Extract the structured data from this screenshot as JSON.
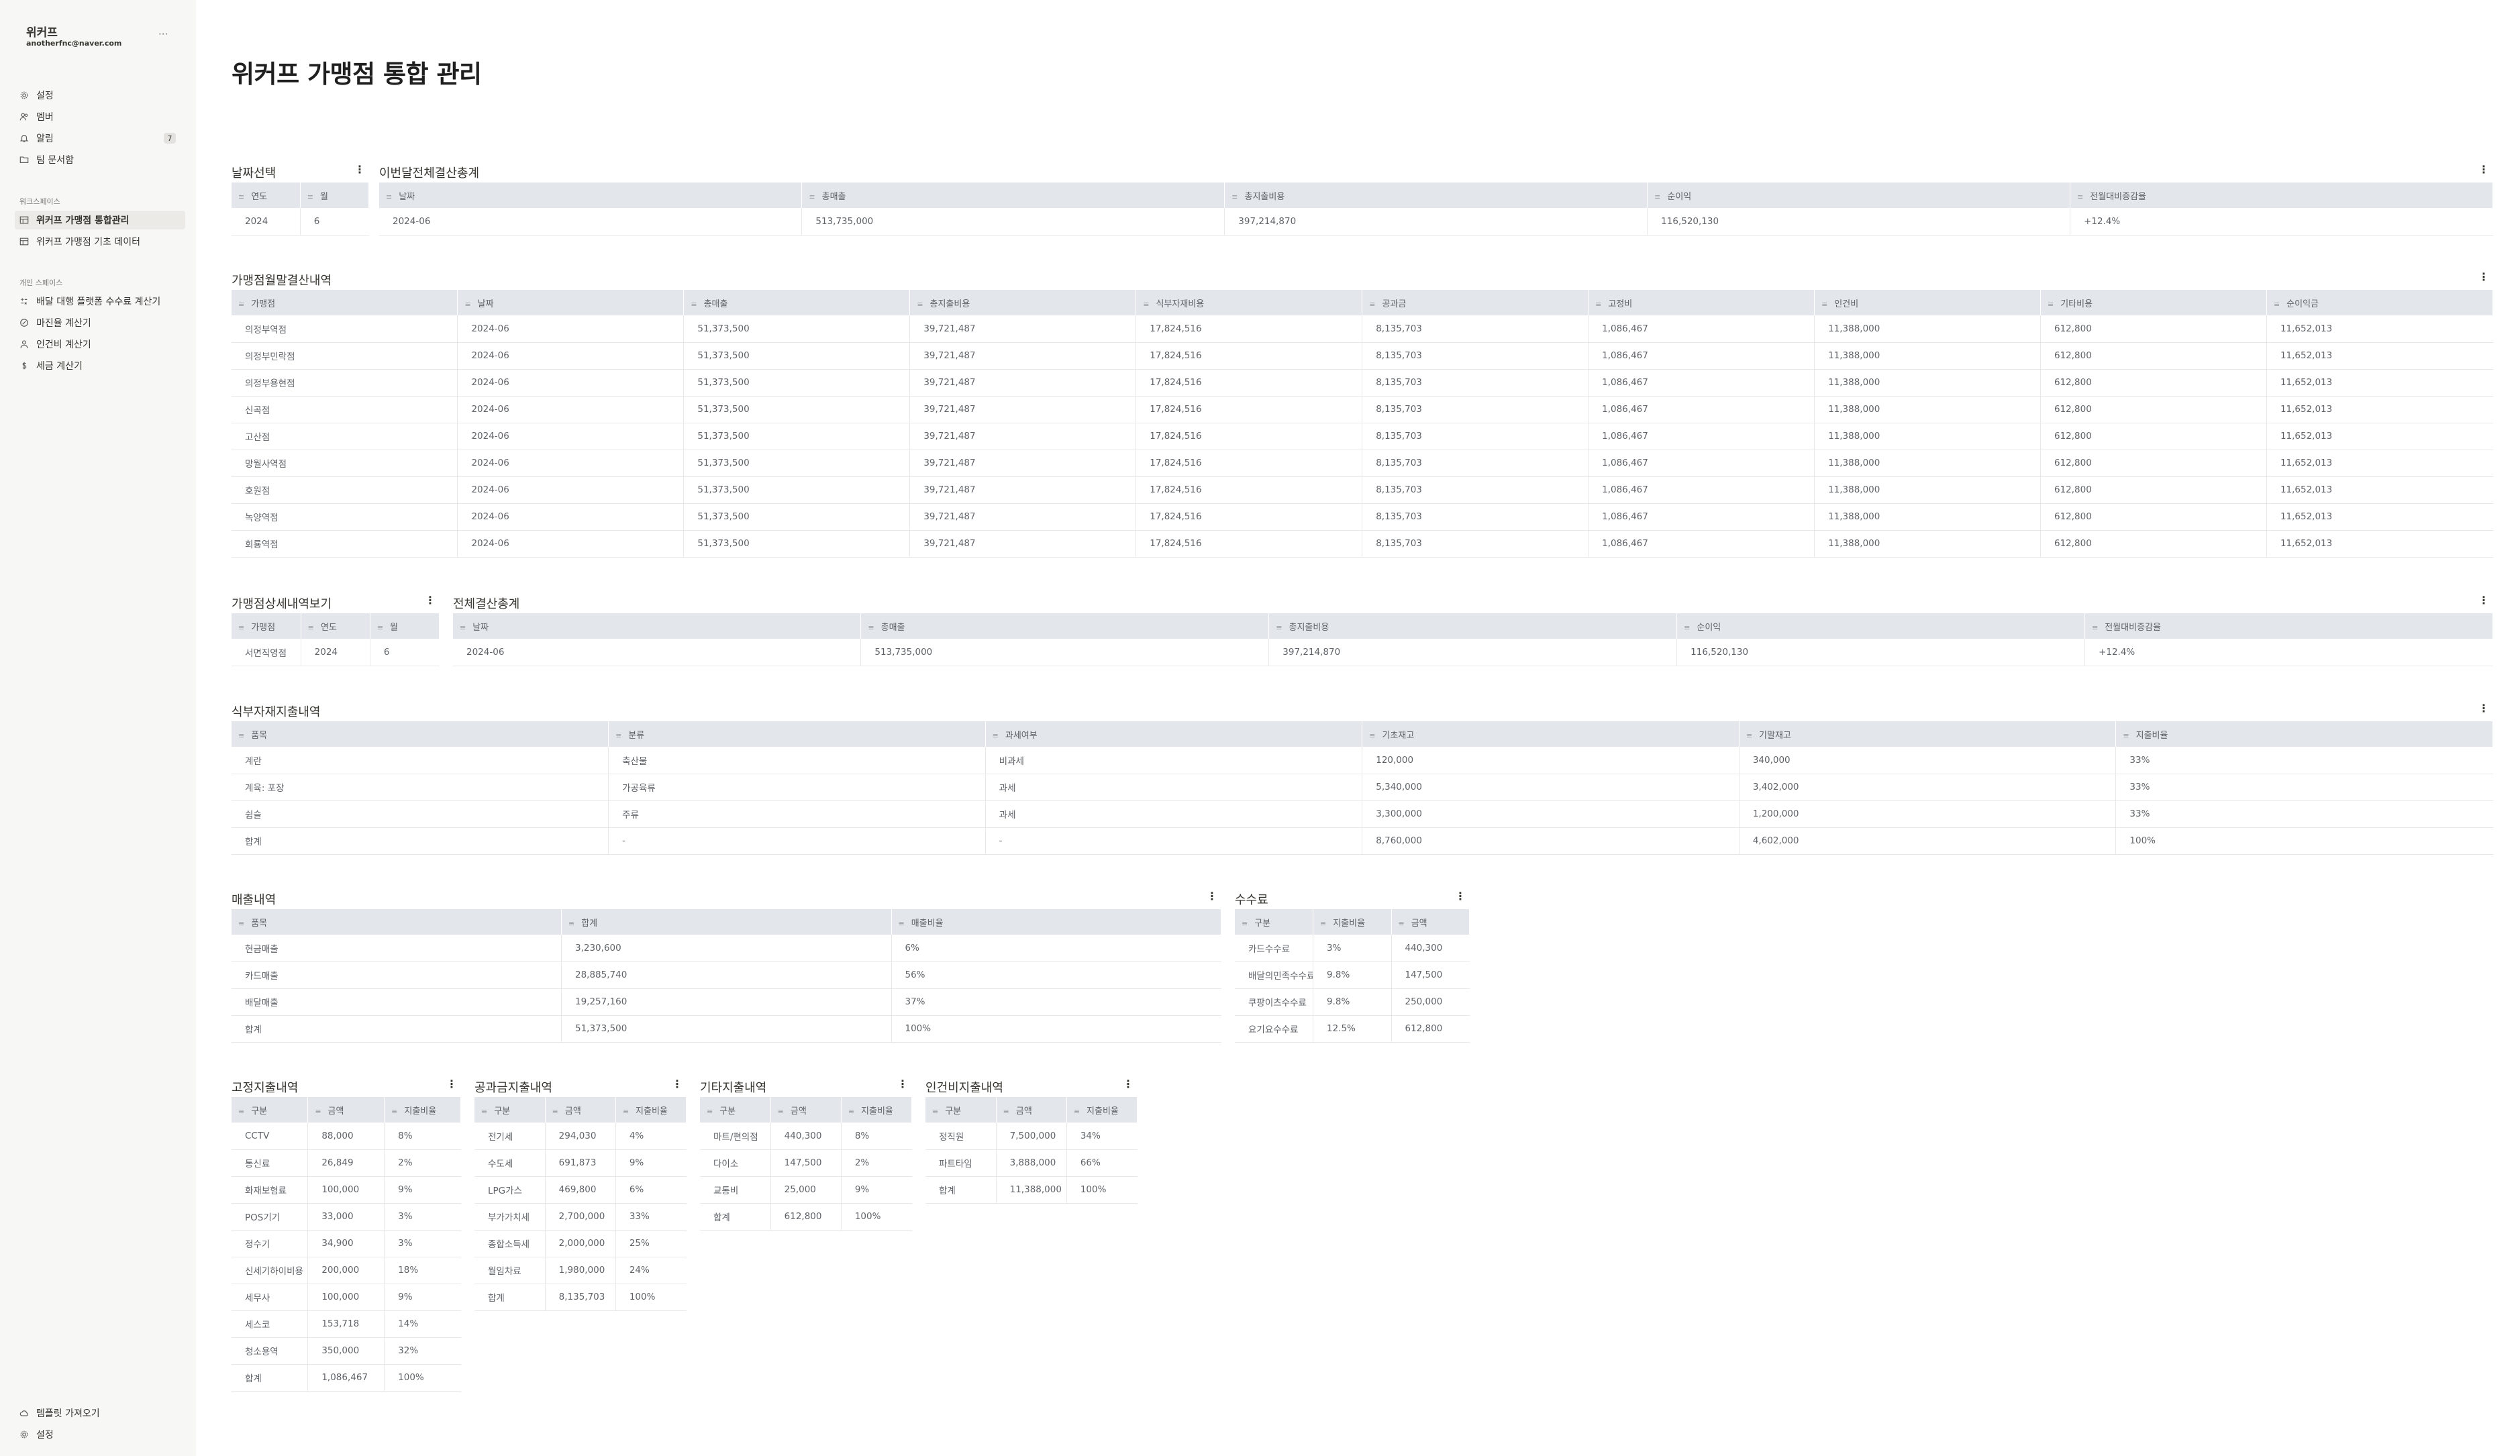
{
  "sidebar": {
    "workspace_name": "위커프",
    "email": "anotherfnc@naver.com",
    "more": "···",
    "top_items": [
      {
        "label": "설정",
        "icon": "gear-icon"
      },
      {
        "label": "멤버",
        "icon": "members-icon"
      },
      {
        "label": "알림",
        "icon": "bell-icon",
        "badge": "7"
      },
      {
        "label": "팀 문서함",
        "icon": "folder-icon"
      }
    ],
    "section_team": "워크스페이스",
    "team_items": [
      {
        "label": "위커프 가맹점 통합관리",
        "icon": "table-icon",
        "active": true
      },
      {
        "label": "위커프 가맹점 기초 데이터",
        "icon": "table-icon",
        "active": false
      }
    ],
    "section_personal": "개인 스페이스",
    "personal_items": [
      {
        "label": "배달 대행 플랫폼 수수료 계산기",
        "icon": "calculator-icon"
      },
      {
        "label": "마진율 계산기",
        "icon": "percent-icon"
      },
      {
        "label": "인건비 계산기",
        "icon": "person-icon"
      },
      {
        "label": "세금 계산기",
        "icon": "dollar-icon"
      }
    ],
    "bottom_items": [
      {
        "label": "템플릿 가져오기",
        "icon": "cloud-icon"
      },
      {
        "label": "설정",
        "icon": "gear-icon"
      }
    ]
  },
  "page_title": "위커프 가맹점 통합 관리",
  "views": {
    "date_select": {
      "title": "날짜선택",
      "columns": [
        "연도",
        "월"
      ],
      "rows": [
        [
          "2024",
          "6"
        ]
      ]
    },
    "month_total": {
      "title": "이번달전체결산총계",
      "columns": [
        "날짜",
        "총매출",
        "총지출비용",
        "순이익",
        "전월대비증감율"
      ],
      "rows": [
        [
          "2024-06",
          "513,735,000",
          "397,214,870",
          "116,520,130",
          "+12.4%"
        ]
      ]
    },
    "store_monthly": {
      "title": "가맹점월말결산내역",
      "columns": [
        "가맹점",
        "날짜",
        "총매출",
        "총지출비용",
        "식부자재비용",
        "공과금",
        "고정비",
        "인건비",
        "기타비용",
        "순이익금"
      ],
      "rows": [
        [
          "의정부역점",
          "2024-06",
          "51,373,500",
          "39,721,487",
          "17,824,516",
          "8,135,703",
          "1,086,467",
          "11,388,000",
          "612,800",
          "11,652,013"
        ],
        [
          "의정부민락점",
          "2024-06",
          "51,373,500",
          "39,721,487",
          "17,824,516",
          "8,135,703",
          "1,086,467",
          "11,388,000",
          "612,800",
          "11,652,013"
        ],
        [
          "의정부용현점",
          "2024-06",
          "51,373,500",
          "39,721,487",
          "17,824,516",
          "8,135,703",
          "1,086,467",
          "11,388,000",
          "612,800",
          "11,652,013"
        ],
        [
          "신곡점",
          "2024-06",
          "51,373,500",
          "39,721,487",
          "17,824,516",
          "8,135,703",
          "1,086,467",
          "11,388,000",
          "612,800",
          "11,652,013"
        ],
        [
          "고산점",
          "2024-06",
          "51,373,500",
          "39,721,487",
          "17,824,516",
          "8,135,703",
          "1,086,467",
          "11,388,000",
          "612,800",
          "11,652,013"
        ],
        [
          "망월사역점",
          "2024-06",
          "51,373,500",
          "39,721,487",
          "17,824,516",
          "8,135,703",
          "1,086,467",
          "11,388,000",
          "612,800",
          "11,652,013"
        ],
        [
          "호원점",
          "2024-06",
          "51,373,500",
          "39,721,487",
          "17,824,516",
          "8,135,703",
          "1,086,467",
          "11,388,000",
          "612,800",
          "11,652,013"
        ],
        [
          "녹양역점",
          "2024-06",
          "51,373,500",
          "39,721,487",
          "17,824,516",
          "8,135,703",
          "1,086,467",
          "11,388,000",
          "612,800",
          "11,652,013"
        ],
        [
          "회룡역점",
          "2024-06",
          "51,373,500",
          "39,721,487",
          "17,824,516",
          "8,135,703",
          "1,086,467",
          "11,388,000",
          "612,800",
          "11,652,013"
        ]
      ]
    },
    "store_detail": {
      "title": "가맹점상세내역보기",
      "columns": [
        "가맹점",
        "연도",
        "월"
      ],
      "rows": [
        [
          "서면직영점",
          "2024",
          "6"
        ]
      ]
    },
    "total_summary": {
      "title": "전체결산총계",
      "columns": [
        "날짜",
        "총매출",
        "총지출비용",
        "순이익",
        "전월대비증감율"
      ],
      "rows": [
        [
          "2024-06",
          "513,735,000",
          "397,214,870",
          "116,520,130",
          "+12.4%"
        ]
      ]
    },
    "food_material": {
      "title": "식부자재지출내역",
      "columns": [
        "품목",
        "분류",
        "과세여부",
        "기초재고",
        "기말재고",
        "지출비율"
      ],
      "rows": [
        [
          "계란",
          "축산물",
          "비과세",
          "120,000",
          "340,000",
          "33%"
        ],
        [
          "계육: 포장",
          "가공육류",
          "과세",
          "5,340,000",
          "3,402,000",
          "33%"
        ],
        [
          "쉼슬",
          "주류",
          "과세",
          "3,300,000",
          "1,200,000",
          "33%"
        ],
        [
          "합계",
          "-",
          "-",
          "8,760,000",
          "4,602,000",
          "100%"
        ]
      ]
    },
    "sales": {
      "title": "매출내역",
      "columns": [
        "품목",
        "합계",
        "매출비율"
      ],
      "rows": [
        [
          "현금매출",
          "3,230,600",
          "6%"
        ],
        [
          "카드매출",
          "28,885,740",
          "56%"
        ],
        [
          "배달매출",
          "19,257,160",
          "37%"
        ],
        [
          "합계",
          "51,373,500",
          "100%"
        ]
      ]
    },
    "fees": {
      "title": "수수료",
      "columns": [
        "구분",
        "지출비율",
        "금액"
      ],
      "rows": [
        [
          "카드수수료",
          "3%",
          "440,300"
        ],
        [
          "배달의민족수수료",
          "9.8%",
          "147,500"
        ],
        [
          "쿠팡이츠수수료",
          "9.8%",
          "250,000"
        ],
        [
          "요기요수수료",
          "12.5%",
          "612,800"
        ]
      ]
    },
    "fixed_expense": {
      "title": "고정지출내역",
      "columns": [
        "구분",
        "금액",
        "지출비율"
      ],
      "rows": [
        [
          "CCTV",
          "88,000",
          "8%"
        ],
        [
          "통신료",
          "26,849",
          "2%"
        ],
        [
          "화재보험료",
          "100,000",
          "9%"
        ],
        [
          "POS기기",
          "33,000",
          "3%"
        ],
        [
          "정수기",
          "34,900",
          "3%"
        ],
        [
          "신세기하이비용",
          "200,000",
          "18%"
        ],
        [
          "세무사",
          "100,000",
          "9%"
        ],
        [
          "세스코",
          "153,718",
          "14%"
        ],
        [
          "청소용역",
          "350,000",
          "32%"
        ],
        [
          "합계",
          "1,086,467",
          "100%"
        ]
      ]
    },
    "utilities": {
      "title": "공과금지출내역",
      "columns": [
        "구분",
        "금액",
        "지출비율"
      ],
      "rows": [
        [
          "전기세",
          "294,030",
          "4%"
        ],
        [
          "수도세",
          "691,873",
          "9%"
        ],
        [
          "LPG가스",
          "469,800",
          "6%"
        ],
        [
          "부가가치세",
          "2,700,000",
          "33%"
        ],
        [
          "종합소득세",
          "2,000,000",
          "25%"
        ],
        [
          "월임차료",
          "1,980,000",
          "24%"
        ],
        [
          "합계",
          "8,135,703",
          "100%"
        ]
      ]
    },
    "other_expense": {
      "title": "기타지출내역",
      "columns": [
        "구분",
        "금액",
        "지출비율"
      ],
      "rows": [
        [
          "마트/편의점",
          "440,300",
          "8%"
        ],
        [
          "다이소",
          "147,500",
          "2%"
        ],
        [
          "교통비",
          "25,000",
          "9%"
        ],
        [
          "합계",
          "612,800",
          "100%"
        ]
      ]
    },
    "labor": {
      "title": "인건비지출내역",
      "columns": [
        "구분",
        "금액",
        "지출비율"
      ],
      "rows": [
        [
          "정직원",
          "7,500,000",
          "34%"
        ],
        [
          "파트타임",
          "3,888,000",
          "66%"
        ],
        [
          "합계",
          "11,388,000",
          "100%"
        ]
      ]
    }
  }
}
